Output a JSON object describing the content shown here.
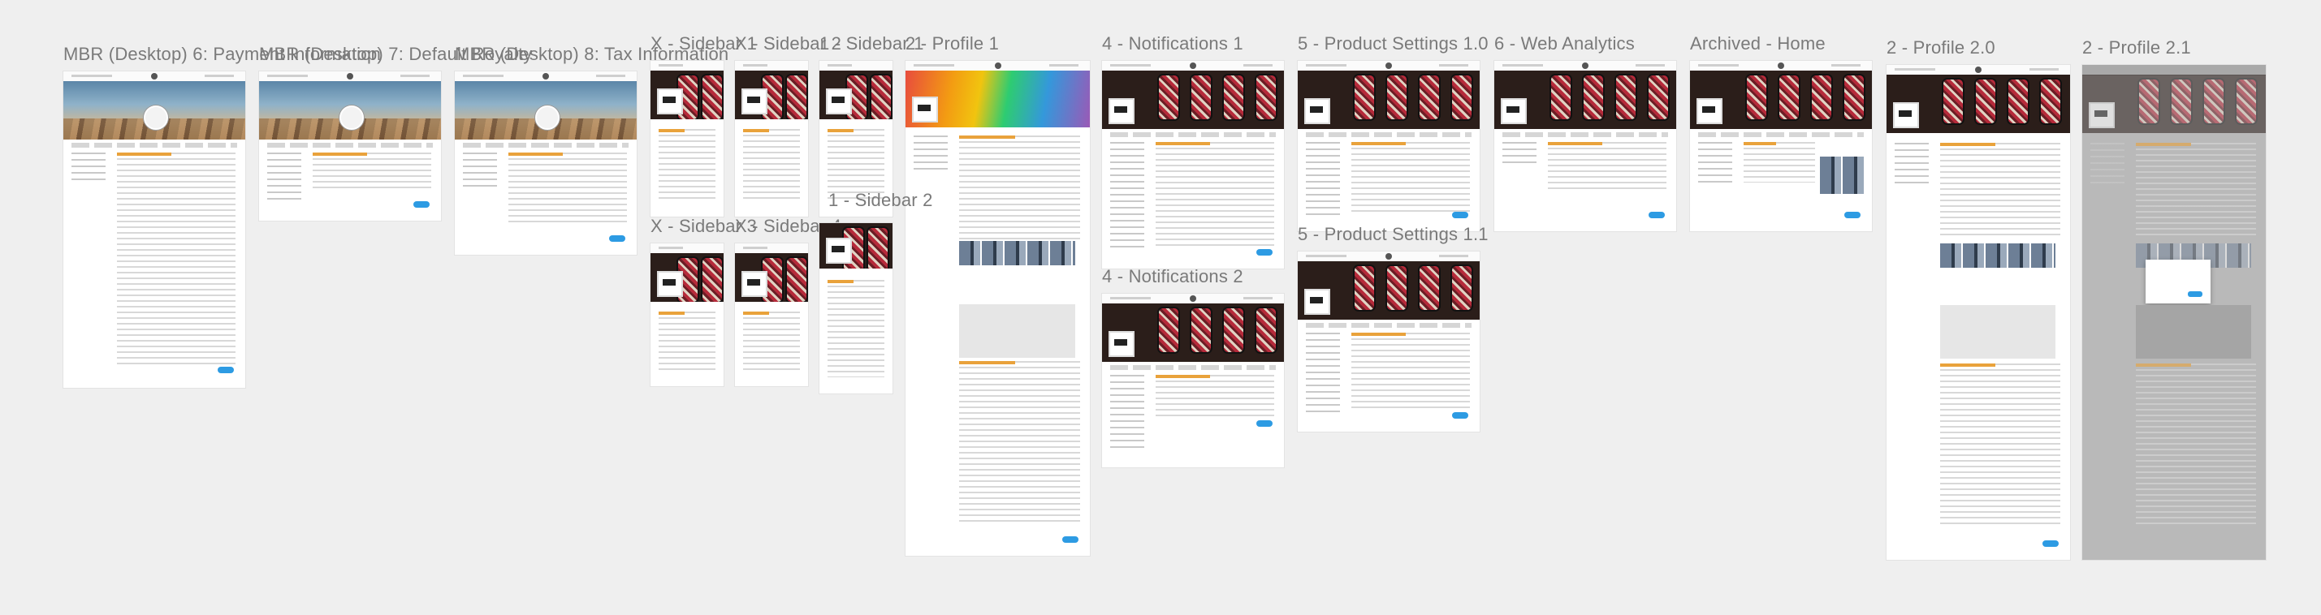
{
  "canvas": {
    "background": "#efefef",
    "accent_button": "#2d9be3",
    "heading_accent": "#e9a23b"
  },
  "boards": [
    {
      "title": "MBR (Desktop) 6: Payment Information",
      "banner": "sky"
    },
    {
      "title": "MBR (Desktop) 7: Default Royalty",
      "banner": "sky"
    },
    {
      "title": "MBR (Desktop) 8: Tax Information",
      "banner": "sky"
    },
    {
      "title": "X - Sidebar 1",
      "banner": "phones"
    },
    {
      "title": "X - Sidebar 2",
      "banner": "phones"
    },
    {
      "title": "1 - Sidebar 1",
      "banner": "phones"
    },
    {
      "title": "2 - Profile 1",
      "banner": "colors"
    },
    {
      "title": "4 - Notifications 1",
      "banner": "phones"
    },
    {
      "title": "5 - Product Settings 1.0",
      "banner": "phones"
    },
    {
      "title": "6 - Web Analytics",
      "banner": "phones"
    },
    {
      "title": "Archived - Home",
      "banner": "phones"
    },
    {
      "title": "2 - Profile 2.0",
      "banner": "phones"
    },
    {
      "title": "2 - Profile 2.1",
      "banner": "phones"
    },
    {
      "title": "1 - Sidebar 2",
      "banner": "phones"
    },
    {
      "title": "X - Sidebar 3",
      "banner": "phones"
    },
    {
      "title": "X - Sidebar 4",
      "banner": "phones"
    },
    {
      "title": "4 - Notifications 2",
      "banner": "phones"
    },
    {
      "title": "5 - Product Settings 1.1",
      "banner": "phones"
    }
  ]
}
